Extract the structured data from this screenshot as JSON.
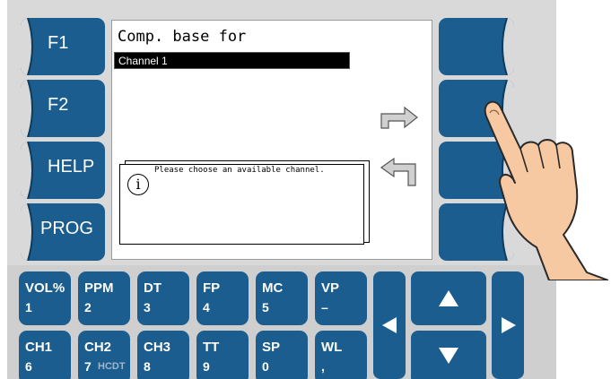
{
  "screen": {
    "title": "Comp. base for",
    "selected_value": "Channel 1",
    "message": "Please choose an available channel.",
    "info_icon_glyph": "i"
  },
  "left_keys": [
    {
      "label": "F1"
    },
    {
      "label": "F2"
    },
    {
      "label": "HELP"
    },
    {
      "label": "PROG"
    }
  ],
  "keypad": {
    "row1": [
      {
        "top": "VOL%",
        "bottom": "1"
      },
      {
        "top": "PPM",
        "bottom": "2"
      },
      {
        "top": "DT",
        "bottom": "3"
      },
      {
        "top": "FP",
        "bottom": "4"
      },
      {
        "top": "MC",
        "bottom": "5"
      },
      {
        "top": "VP",
        "bottom": "–"
      }
    ],
    "row2": [
      {
        "top": "CH1",
        "bottom": "6",
        "sub": ""
      },
      {
        "top": "CH2",
        "bottom": "7",
        "sub": "HCDT"
      },
      {
        "top": "CH3",
        "bottom": "8",
        "sub": ""
      },
      {
        "top": "TT",
        "bottom": "9",
        "sub": ""
      },
      {
        "top": "SP",
        "bottom": "0",
        "sub": ""
      },
      {
        "top": "WL",
        "bottom": ",",
        "sub": ""
      }
    ]
  },
  "icons": {
    "next": "arrow-right-icon",
    "back": "arrow-return-left-icon",
    "info": "info-icon",
    "hand": "pointing-hand-icon"
  },
  "colors": {
    "button_blue": "#1b5d8e",
    "panel_gray": "#d9d9d9",
    "hint_text": "#9fb7cc"
  }
}
